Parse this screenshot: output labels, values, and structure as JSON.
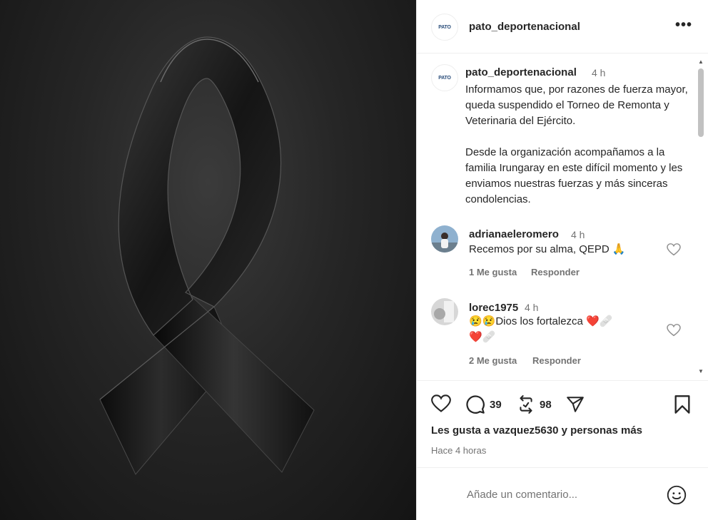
{
  "post": {
    "username": "pato_deportenacional",
    "logo_text": "PATO",
    "image_alt": "Cinta negra de luto"
  },
  "caption": {
    "username": "pato_deportenacional",
    "time": "4 h",
    "text": "Informamos que, por razones de fuerza mayor, queda suspendido el Torneo de Remonta y Veterinaria del Ejército.\n\nDesde la organización acompañamos a la familia Irungaray en este difícil momento y les enviamos nuestras fuerzas y más sinceras condolencias."
  },
  "comments": [
    {
      "username": "adrianaeleromero",
      "time": "4 h",
      "text": "Recemos por su alma, QEPD 🙏",
      "likes": "1 Me gusta",
      "reply": "Responder"
    },
    {
      "username": "lorec1975",
      "time": "4 h",
      "text_line1": "😢😢Dios los fortalezca ❤️🩹",
      "text_line2": "❤️🩹",
      "likes": "2 Me gusta",
      "reply": "Responder"
    }
  ],
  "actions": {
    "comment_count": "39",
    "repost_count": "98",
    "likes_prefix": "Les gusta a ",
    "likes_user": "vazquez5630",
    "likes_suffix": " y personas más",
    "time_ago": "Hace 4 horas"
  },
  "add_comment": {
    "placeholder": "Añade un comentario..."
  },
  "icons": {
    "more": "more-options-icon",
    "like": "heart-icon",
    "comment": "comment-bubble-icon",
    "repost": "repost-icon",
    "share": "send-icon",
    "save": "bookmark-icon",
    "emoji": "emoji-icon"
  }
}
